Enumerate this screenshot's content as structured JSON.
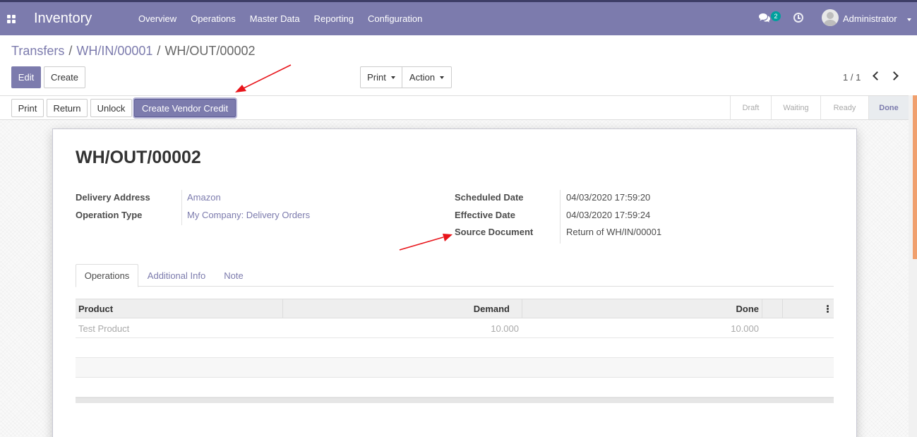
{
  "navbar": {
    "app_name": "Inventory",
    "menu": [
      "Overview",
      "Operations",
      "Master Data",
      "Reporting",
      "Configuration"
    ],
    "chat_count": "2",
    "user": "Administrator"
  },
  "breadcrumb": {
    "items": [
      "Transfers",
      "WH/IN/00001"
    ],
    "current": "WH/OUT/00002",
    "separator": "/"
  },
  "control": {
    "edit_label": "Edit",
    "create_label": "Create",
    "print_label": "Print",
    "action_label": "Action",
    "pager": "1 / 1"
  },
  "statusbar": {
    "buttons": {
      "print": "Print",
      "return": "Return",
      "unlock": "Unlock",
      "vendor_credit": "Create Vendor Credit"
    },
    "stages": [
      "Draft",
      "Waiting",
      "Ready",
      "Done"
    ],
    "active_stage": "Done"
  },
  "record": {
    "name": "WH/OUT/00002",
    "delivery_address_label": "Delivery Address",
    "delivery_address": "Amazon",
    "operation_type_label": "Operation Type",
    "operation_type": "My Company: Delivery Orders",
    "scheduled_date_label": "Scheduled Date",
    "scheduled_date": "04/03/2020 17:59:20",
    "effective_date_label": "Effective Date",
    "effective_date": "04/03/2020 17:59:24",
    "source_document_label": "Source Document",
    "source_document": "Return of WH/IN/00001"
  },
  "tabs": [
    "Operations",
    "Additional Info",
    "Note"
  ],
  "active_tab": "Operations",
  "operations_table": {
    "columns": [
      "Product",
      "Demand",
      "Done"
    ],
    "rows": [
      {
        "product": "Test Product",
        "demand": "10.000",
        "done": "10.000"
      }
    ]
  },
  "colors": {
    "brand": "#7c7bad",
    "annotation_arrow": "#e8141a"
  }
}
